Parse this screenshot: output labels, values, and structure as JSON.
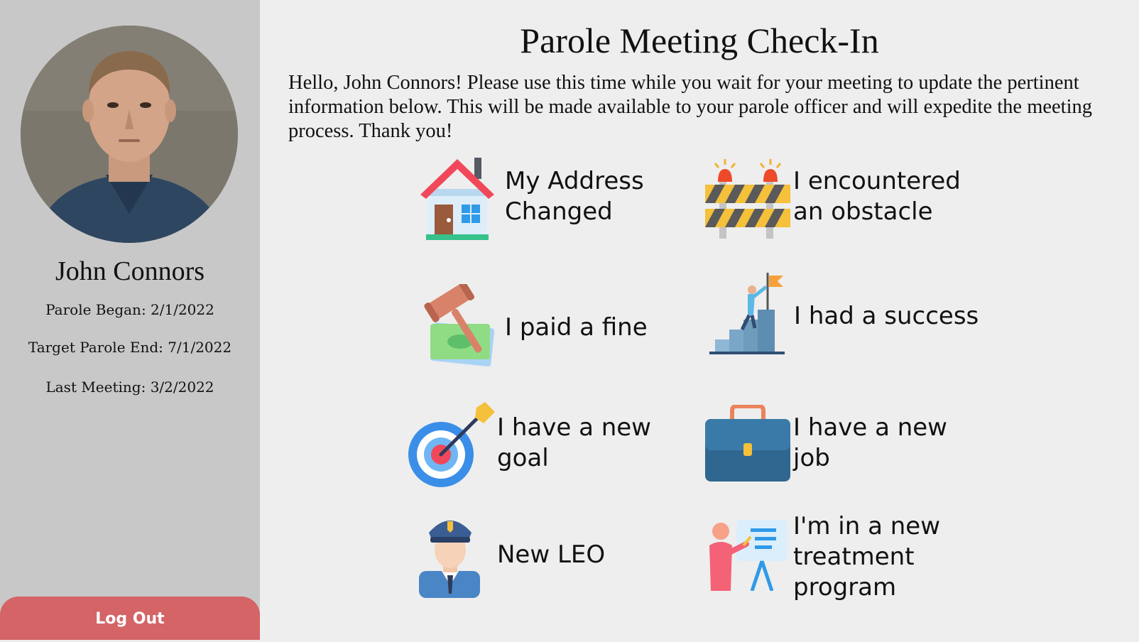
{
  "sidebar": {
    "user_name": "John Connors",
    "parole_began": "Parole Began: 2/1/2022",
    "target_parole_end": "Target Parole End: 7/1/2022",
    "last_meeting": "Last Meeting: 3/2/2022",
    "logout_label": "Log Out"
  },
  "main": {
    "title": "Parole Meeting Check-In",
    "intro": "Hello, John Connors! Please use this time while you wait for your meeting to update the pertinent information below. This will be made available to your parole officer and will expedite the meeting process. Thank you!",
    "options": {
      "address": {
        "label": "My Address Changed",
        "icon": "house-icon"
      },
      "obstacle": {
        "label": "I encountered an obstacle",
        "icon": "barrier-icon"
      },
      "fine": {
        "label": "I paid a fine",
        "icon": "gavel-money-icon"
      },
      "success": {
        "label": "I had a success",
        "icon": "flag-summit-icon"
      },
      "goal": {
        "label": "I have a new goal",
        "icon": "target-icon"
      },
      "job": {
        "label": "I have a new job",
        "icon": "briefcase-icon"
      },
      "leo": {
        "label": "New LEO",
        "icon": "police-officer-icon"
      },
      "treatment": {
        "label": "I'm in a new treatment program",
        "icon": "presentation-icon"
      }
    }
  },
  "colors": {
    "sidebar_bg": "#c8c8c8",
    "page_bg": "#eeeeee",
    "logout_bg": "#d46466"
  }
}
